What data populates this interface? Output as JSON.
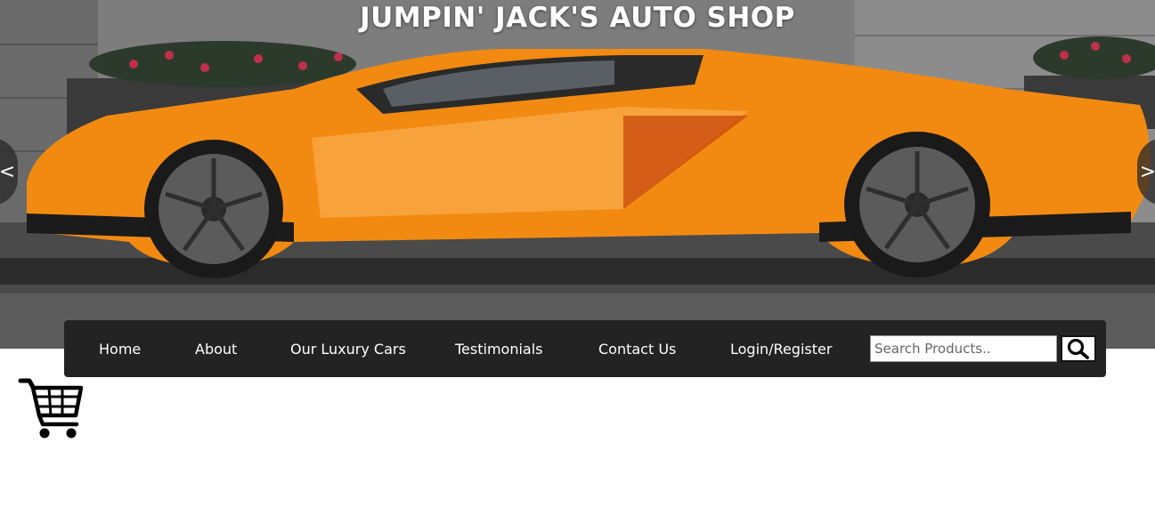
{
  "header": {
    "title": "JUMPIN' JACK'S AUTO SHOP"
  },
  "hero": {
    "image": "orange-sports-car",
    "car_color": "#f28a12",
    "prev_arrow": "<",
    "next_arrow": ">"
  },
  "nav": {
    "items": [
      {
        "label": "Home"
      },
      {
        "label": "About"
      },
      {
        "label": "Our Luxury Cars"
      },
      {
        "label": "Testimonials"
      },
      {
        "label": "Contact Us"
      },
      {
        "label": "Login/Register"
      }
    ],
    "search": {
      "placeholder": "Search Products..",
      "value": "",
      "icon": "search-icon"
    }
  },
  "cart": {
    "icon": "shopping-cart-icon"
  },
  "colors": {
    "navbar_bg": "#232323",
    "nav_text": "#ffffff",
    "page_bg": "#ffffff"
  }
}
